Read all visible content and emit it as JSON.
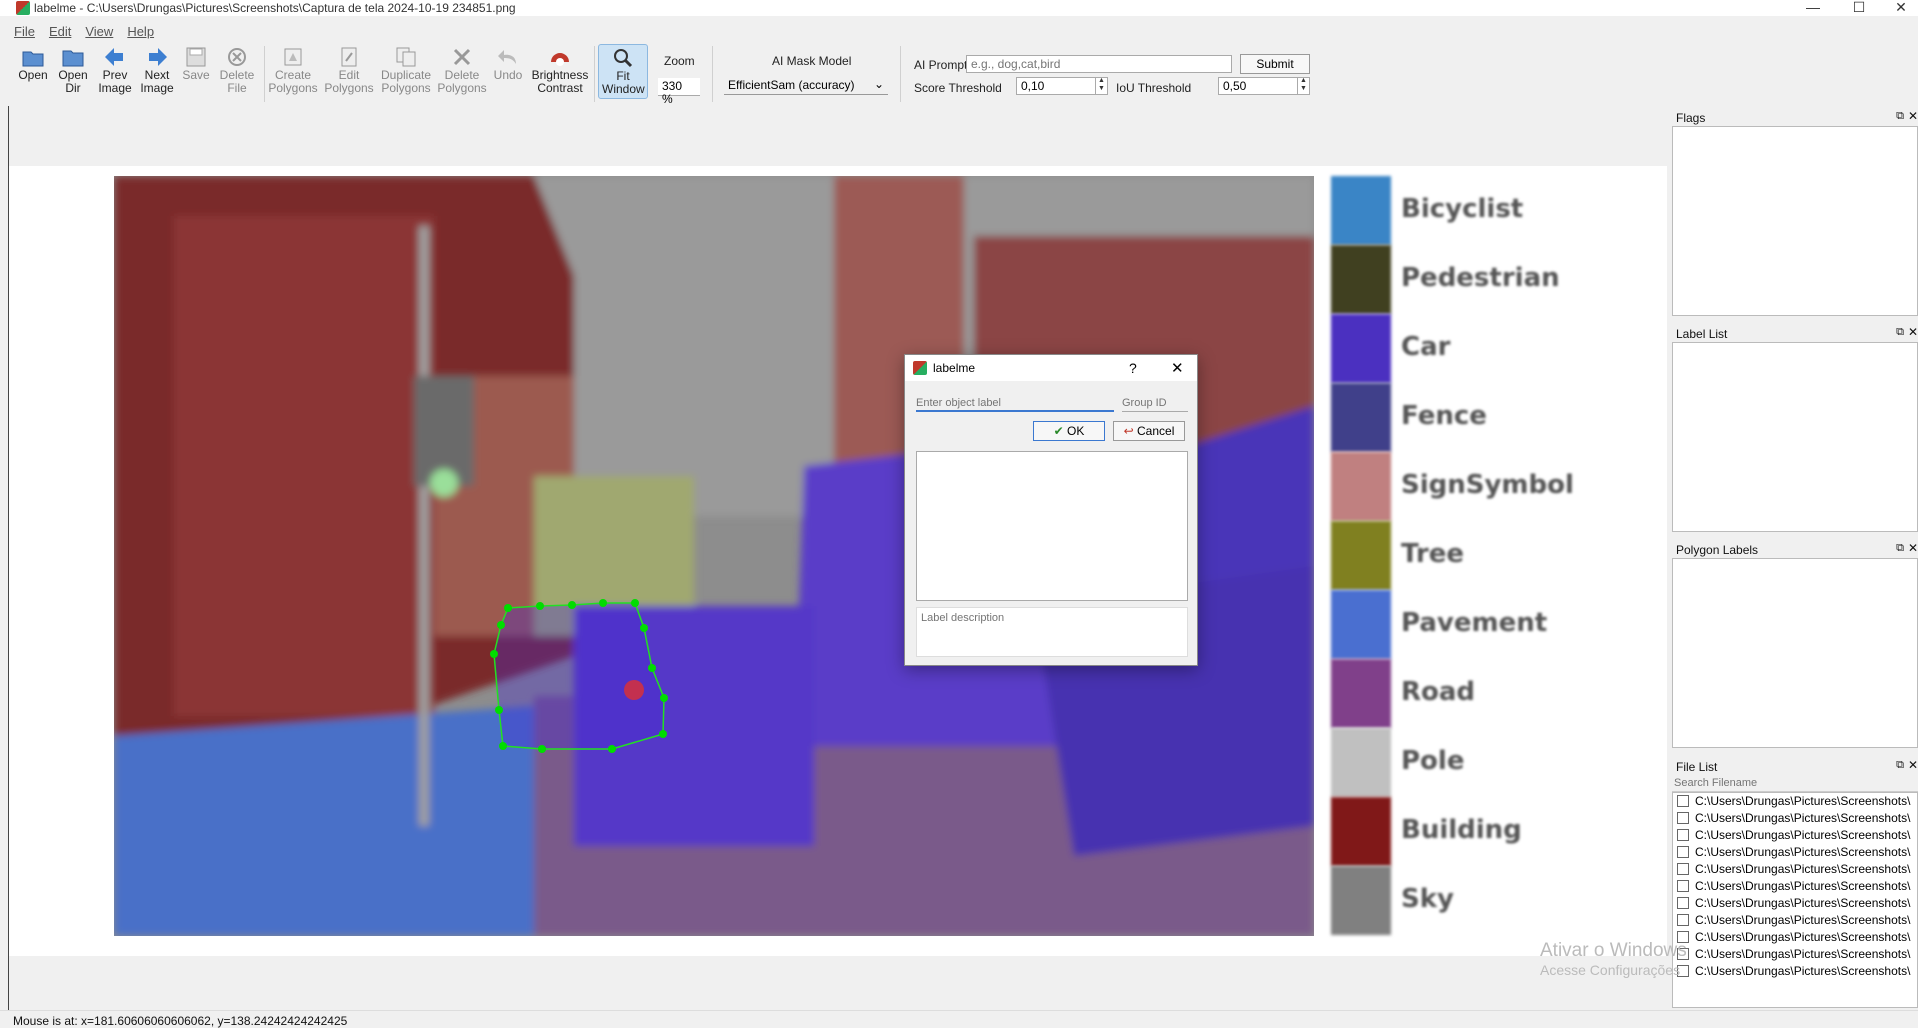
{
  "window": {
    "title": "labelme - C:\\Users\\Drungas\\Pictures\\Screenshots\\Captura de tela 2024-10-19 234851.png",
    "minimize": "—",
    "maximize": "☐",
    "close": "✕"
  },
  "menu": [
    "File",
    "Edit",
    "View",
    "Help"
  ],
  "toolbar": {
    "open": [
      "Open"
    ],
    "open_dir": [
      "Open",
      "Dir"
    ],
    "prev": [
      "Prev",
      "Image"
    ],
    "next": [
      "Next",
      "Image"
    ],
    "save": [
      "Save"
    ],
    "delete_file": [
      "Delete",
      "File"
    ],
    "create": [
      "Create",
      "Polygons"
    ],
    "edit": [
      "Edit",
      "Polygons"
    ],
    "duplicate": [
      "Duplicate",
      "Polygons"
    ],
    "delete_poly": [
      "Delete",
      "Polygons"
    ],
    "undo": [
      "Undo"
    ],
    "brightness": [
      "Brightness",
      "Contrast"
    ],
    "fit": [
      "Fit",
      "Window"
    ],
    "zoom_label": "Zoom",
    "zoom_value": "330 %",
    "ai_mask_label": "AI Mask Model",
    "ai_mask_value": "EfficientSam (accuracy)",
    "ai_prompt_label": "AI Prompt",
    "ai_prompt_placeholder": "e.g., dog,cat,bird",
    "submit": "Submit",
    "score_label": "Score Threshold",
    "score_value": "0,10",
    "iou_label": "IoU Threshold",
    "iou_value": "0,50"
  },
  "legend": [
    "Bicyclist",
    "Pedestrian",
    "Car",
    "Fence",
    "SignSymbol",
    "Tree",
    "Pavement",
    "Road",
    "Pole",
    "Building",
    "Sky"
  ],
  "legend_colors": [
    "#3a85c6",
    "#404020",
    "#4b30c0",
    "#40408a",
    "#c08080",
    "#808020",
    "#4a6fd0",
    "#80408a",
    "#c0c0c0",
    "#801818",
    "#808080"
  ],
  "docks": {
    "flags": "Flags",
    "label_list": "Label List",
    "polygon_labels": "Polygon Labels",
    "file_list": "File List",
    "search_placeholder": "Search Filename"
  },
  "files": [
    "C:\\Users\\Drungas\\Pictures\\Screenshots\\",
    "C:\\Users\\Drungas\\Pictures\\Screenshots\\",
    "C:\\Users\\Drungas\\Pictures\\Screenshots\\",
    "C:\\Users\\Drungas\\Pictures\\Screenshots\\",
    "C:\\Users\\Drungas\\Pictures\\Screenshots\\",
    "C:\\Users\\Drungas\\Pictures\\Screenshots\\",
    "C:\\Users\\Drungas\\Pictures\\Screenshots\\",
    "C:\\Users\\Drungas\\Pictures\\Screenshots\\",
    "C:\\Users\\Drungas\\Pictures\\Screenshots\\",
    "C:\\Users\\Drungas\\Pictures\\Screenshots\\",
    "C:\\Users\\Drungas\\Pictures\\Screenshots\\"
  ],
  "dialog": {
    "title": "labelme",
    "help": "?",
    "close": "✕",
    "label_placeholder": "Enter object label",
    "group_placeholder": "Group ID",
    "ok": "OK",
    "cancel": "Cancel",
    "desc_placeholder": "Label description"
  },
  "watermark": {
    "line1": "Ativar o Windows",
    "line2": "Acesse Configurações"
  },
  "status": "Mouse is at: x=181.60606060606062, y=138.24242424242425"
}
